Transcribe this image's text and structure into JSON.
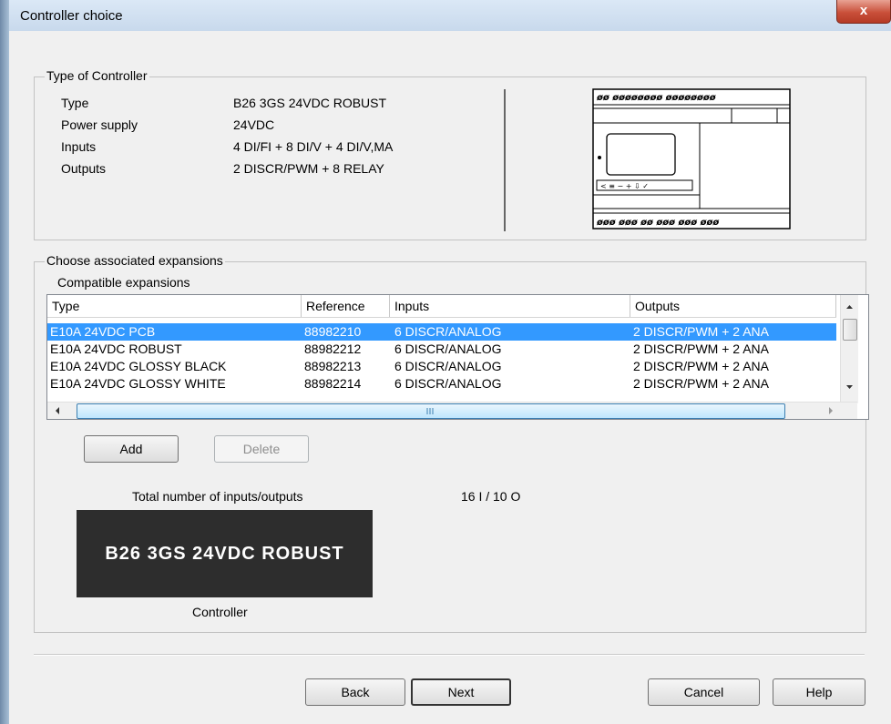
{
  "window": {
    "title": "Controller choice",
    "close_glyph": "x"
  },
  "controller_group": {
    "label": "Type of Controller",
    "rows": [
      {
        "label": "Type",
        "value": "B26 3GS 24VDC ROBUST"
      },
      {
        "label": "Power supply",
        "value": "24VDC"
      },
      {
        "label": "Inputs",
        "value": "4 DI/FI + 8 DI/V + 4 DI/V,MA"
      },
      {
        "label": "Outputs",
        "value": "2 DISCR/PWM + 8 RELAY"
      }
    ],
    "device": {
      "top_terminals": "øø øøøøøøøø øøøøøøøø",
      "bottom_terminals": "øøø øøø øø øøø øøø øøø",
      "keys": "< ≡ − + ⇩ ✓"
    }
  },
  "expansions_group": {
    "label": "Choose associated expansions",
    "compatible_label": "Compatible expansions",
    "columns": [
      "Type",
      "Reference",
      "Inputs",
      "Outputs"
    ],
    "rows": [
      {
        "type": "E10A 24VDC PCB",
        "reference": "88982210",
        "inputs": "6 DISCR/ANALOG",
        "outputs": "2 DISCR/PWM + 2 ANA",
        "selected": true
      },
      {
        "type": "E10A 24VDC ROBUST",
        "reference": "88982212",
        "inputs": "6 DISCR/ANALOG",
        "outputs": "2 DISCR/PWM + 2 ANA",
        "selected": false
      },
      {
        "type": "E10A 24VDC GLOSSY BLACK",
        "reference": "88982213",
        "inputs": "6 DISCR/ANALOG",
        "outputs": "2 DISCR/PWM + 2 ANA",
        "selected": false
      },
      {
        "type": "E10A 24VDC GLOSSY WHITE",
        "reference": "88982214",
        "inputs": "6 DISCR/ANALOG",
        "outputs": "2 DISCR/PWM + 2 ANA",
        "selected": false
      }
    ],
    "add_label": "Add",
    "delete_label": "Delete",
    "total_label": "Total number of inputs/outputs",
    "total_value": "16 I / 10 O",
    "controller_name": "B26 3GS 24VDC ROBUST",
    "controller_caption": "Controller"
  },
  "footer": {
    "back": "Back",
    "next": "Next",
    "cancel": "Cancel",
    "help": "Help"
  },
  "colors": {
    "selection": "#3399ff",
    "controller_box": "#2d2d2d",
    "close_button": "#c9503a"
  }
}
